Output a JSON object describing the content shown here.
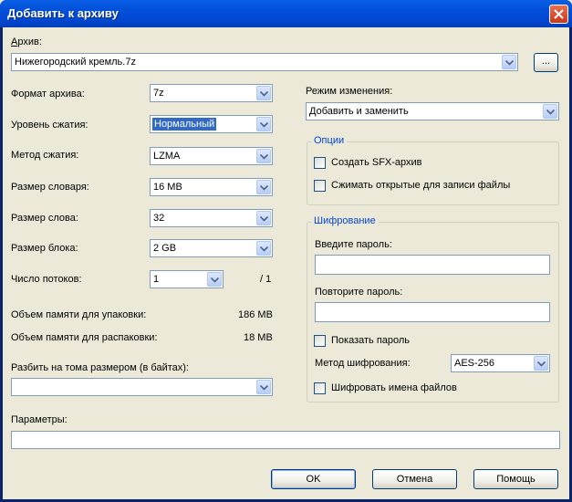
{
  "window": {
    "title": "Добавить к архиву"
  },
  "archive": {
    "label": "Архив:",
    "value": "Нижегородский кремль.7z",
    "browse_label": "..."
  },
  "left": {
    "format": {
      "label": "Формат архива:",
      "value": "7z"
    },
    "level": {
      "label": "Уровень сжатия:",
      "value": "Нормальный"
    },
    "method": {
      "label": "Метод сжатия:",
      "value": "LZMA"
    },
    "dict": {
      "label": "Размер словаря:",
      "value": "16 MB"
    },
    "word": {
      "label": "Размер слова:",
      "value": "32"
    },
    "block": {
      "label": "Размер блока:",
      "value": "2 GB"
    },
    "threads": {
      "label": "Число потоков:",
      "value": "1",
      "max": "/ 1"
    },
    "mem_pack": {
      "label": "Объем памяти для упаковки:",
      "value": "186 MB"
    },
    "mem_unpack": {
      "label": "Объем памяти для распаковки:",
      "value": "18 MB"
    },
    "split": {
      "label": "Разбить на тома размером (в байтах):",
      "value": ""
    },
    "params": {
      "label": "Параметры:",
      "value": ""
    }
  },
  "right": {
    "mode": {
      "label": "Режим изменения:",
      "value": "Добавить и заменить"
    },
    "options": {
      "title": "Опции",
      "sfx": {
        "label": "Создать SFX-архив",
        "checked": false
      },
      "shared": {
        "label": "Сжимать открытые для записи файлы",
        "checked": false
      }
    },
    "encryption": {
      "title": "Шифрование",
      "password_label": "Введите пароль:",
      "password_value": "",
      "repeat_label": "Повторите пароль:",
      "repeat_value": "",
      "show_label": "Показать пароль",
      "method_label": "Метод шифрования:",
      "method_value": "AES-256",
      "names_label": "Шифровать имена файлов"
    }
  },
  "buttons": {
    "ok": "OK",
    "cancel": "Отмена",
    "help": "Помощь"
  },
  "icons": {
    "close": "close-icon",
    "dropdown": "chevron-down-icon"
  },
  "colors": {
    "title_bar": "#0054e3",
    "accent": "#0046d5",
    "selection": "#316ac5",
    "close": "#d8461f"
  }
}
